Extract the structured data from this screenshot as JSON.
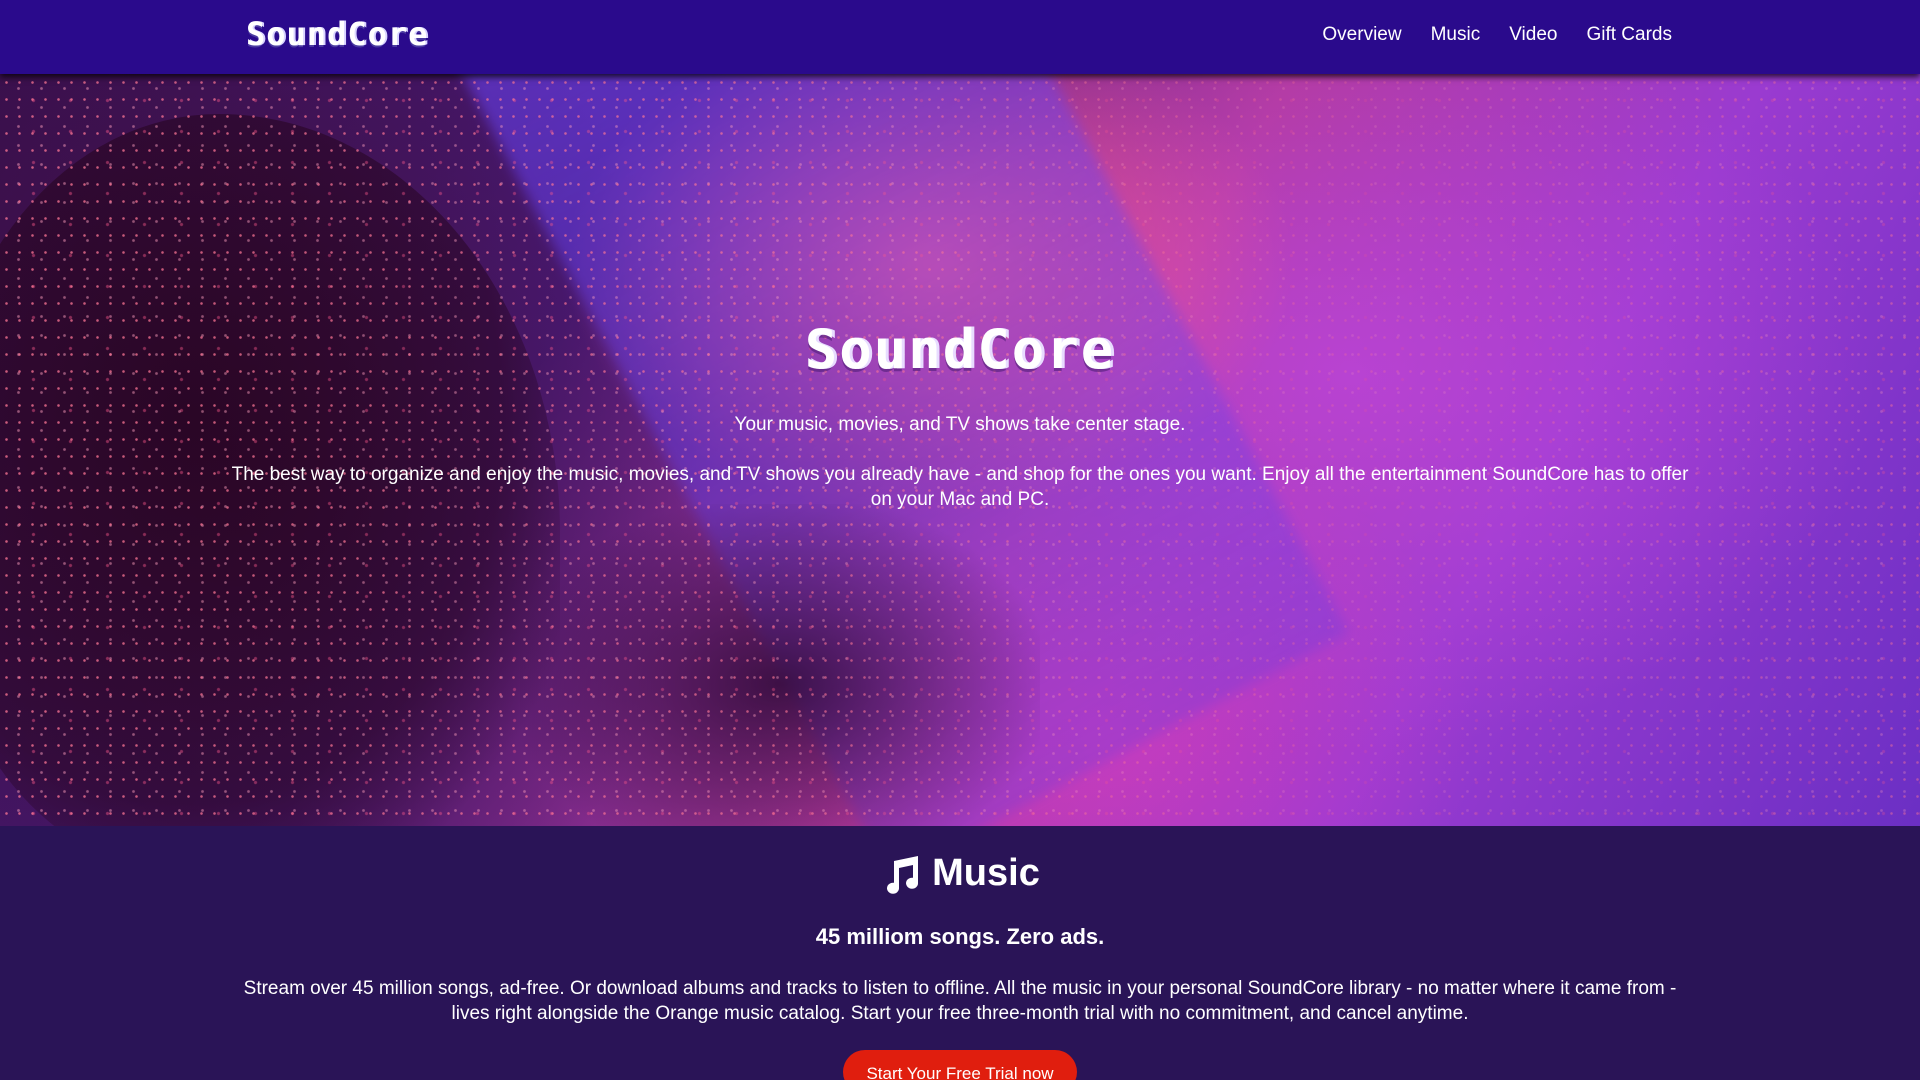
{
  "header": {
    "brand": "SoundCore",
    "nav": [
      {
        "label": "Overview"
      },
      {
        "label": "Music"
      },
      {
        "label": "Video"
      },
      {
        "label": "Gift Cards"
      }
    ]
  },
  "hero": {
    "title": "SoundCore",
    "tagline": "Your music, movies, and TV shows take center stage.",
    "description": "The best way to organize and enjoy the music, movies, and TV shows you already have - and shop for the ones you want. Enjoy all the entertainment SoundCore has to offer on your Mac and PC."
  },
  "music": {
    "icon": "music-note-icon",
    "title": "Music",
    "subtitle": "45 milliom songs. Zero ads.",
    "description": "Stream over 45 million songs, ad-free. Or download albums and tracks to listen to offline. All the music in your personal SoundCore library - no matter where it came from - lives right alongside the Orange music catalog. Start your free three-month trial with no commitment, and cancel anytime.",
    "cta_label": "Start Your Free Trial now"
  },
  "colors": {
    "navbar": "#2a0a8c",
    "section_bg": "#2a1457",
    "cta": "#e01e0e",
    "text": "#ffffff"
  }
}
